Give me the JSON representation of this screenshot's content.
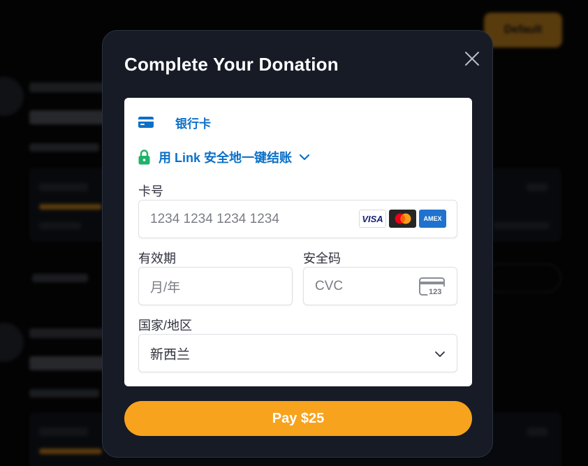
{
  "background": {
    "top_button_label": "Default",
    "posts": [
      {
        "author": "Anonymous",
        "title": "#StartupLife",
        "tag": "#StartupLife",
        "progress_label": "Progress",
        "progress_pct": "30%",
        "raised": "$3.00 raised",
        "goal": "$5.00 goal",
        "reply_label": "Reply",
        "pill_label": "Trending"
      },
      {
        "author": "Anonymous",
        "title": "Help me get",
        "tag": "I need it for",
        "progress_label": "Progress",
        "progress_pct": "30%"
      }
    ]
  },
  "modal": {
    "title": "Complete Your Donation",
    "close_icon": "close-icon",
    "payment_method": {
      "icon": "card-icon",
      "label": "银行卡"
    },
    "link_checkout": {
      "icon": "lock-icon",
      "label": "用 Link 安全地一键结账",
      "chevron_icon": "chevron-down-icon"
    },
    "card_number": {
      "label": "卡号",
      "placeholder": "1234 1234 1234 1234",
      "brands": [
        "VISA",
        "Mastercard",
        "AMEX"
      ]
    },
    "expiry": {
      "label": "有效期",
      "placeholder": "月/年"
    },
    "cvc": {
      "label": "安全码",
      "placeholder": "CVC",
      "icon_text": "123"
    },
    "country": {
      "label": "国家/地区",
      "value": "新西兰"
    },
    "pay_button_label": "Pay $25"
  },
  "colors": {
    "accent": "#f7a31d",
    "link_blue": "#0c70c8",
    "modal_bg": "#171b26",
    "lock_green": "#1fb36a"
  }
}
